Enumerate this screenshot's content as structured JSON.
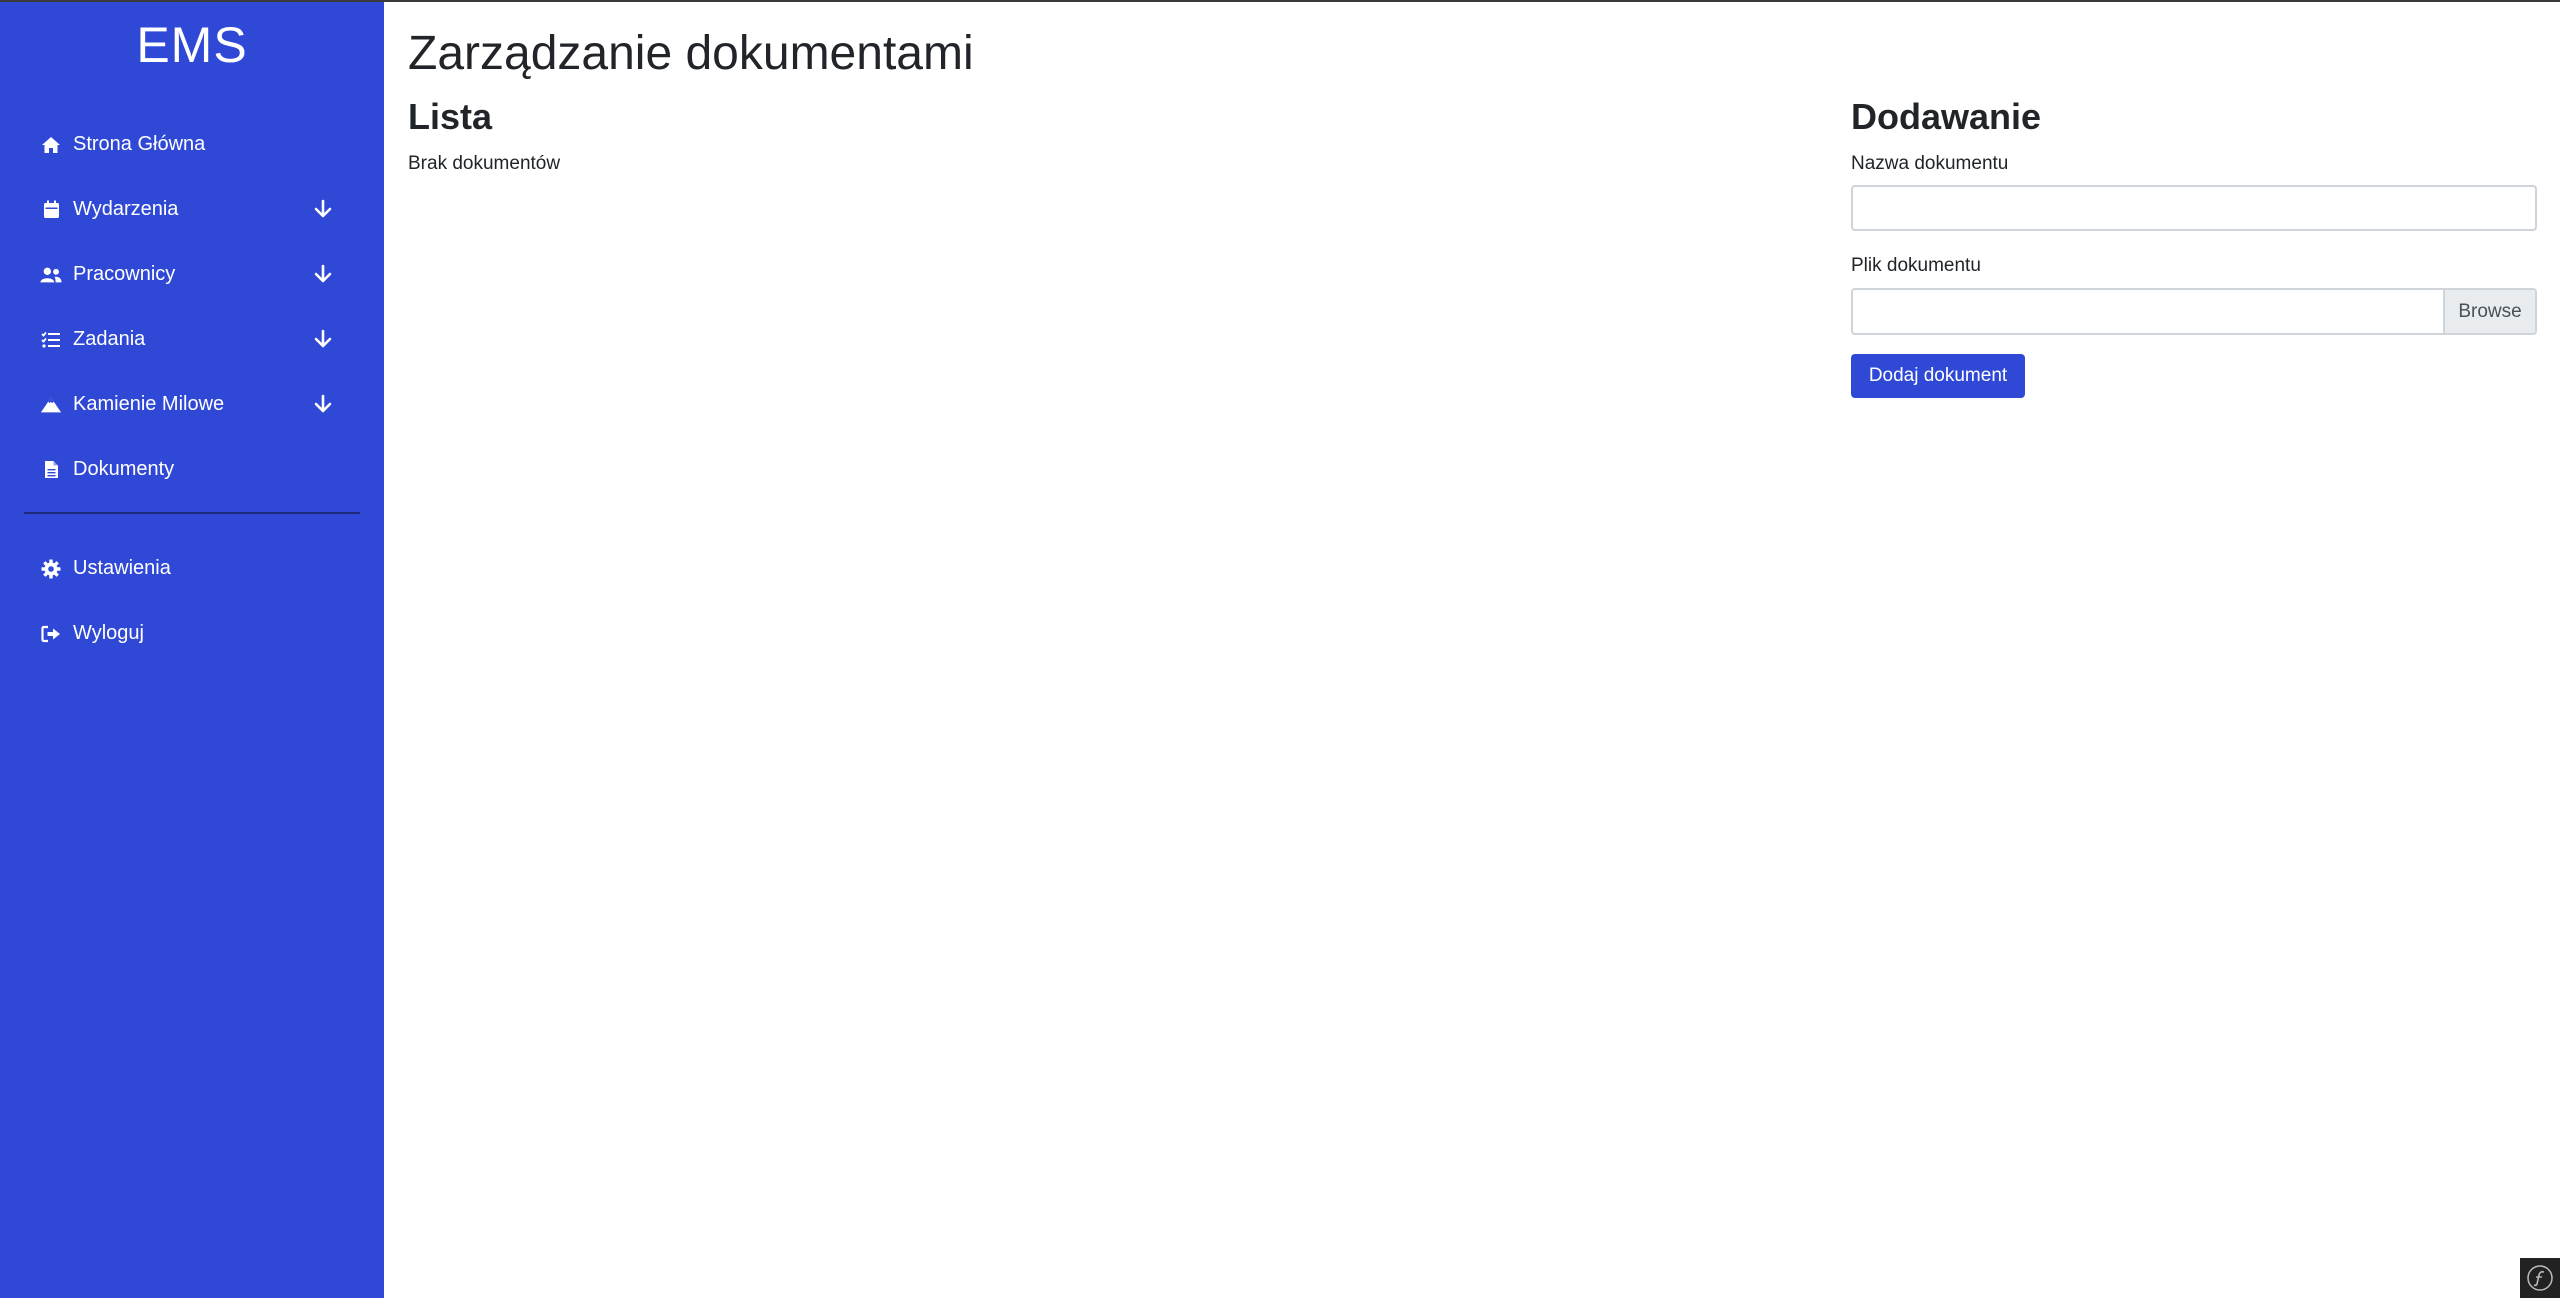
{
  "sidebar": {
    "brand": "EMS",
    "items": [
      {
        "label": "Strona Główna",
        "icon": "home-icon"
      },
      {
        "label": "Wydarzenia",
        "icon": "calendar-icon",
        "expandable": true
      },
      {
        "label": "Pracownicy",
        "icon": "users-icon",
        "expandable": true
      },
      {
        "label": "Zadania",
        "icon": "tasks-icon",
        "expandable": true
      },
      {
        "label": "Kamienie Milowe",
        "icon": "mountain-icon",
        "expandable": true
      },
      {
        "label": "Dokumenty",
        "icon": "file-icon"
      }
    ],
    "bottom_items": [
      {
        "label": "Ustawienia",
        "icon": "gear-icon"
      },
      {
        "label": "Wyloguj",
        "icon": "logout-icon"
      }
    ]
  },
  "main": {
    "title": "Zarządzanie dokumentami",
    "list": {
      "title": "Lista",
      "empty_text": "Brak dokumentów"
    },
    "form": {
      "title": "Dodawanie",
      "name_label": "Nazwa dokumentu",
      "name_value": "",
      "file_label": "Plik dokumentu",
      "file_value": "",
      "browse_label": "Browse",
      "submit_label": "Dodaj dokument"
    }
  },
  "colors": {
    "sidebar_bg": "#3048d6",
    "primary_button": "#3048d6"
  }
}
